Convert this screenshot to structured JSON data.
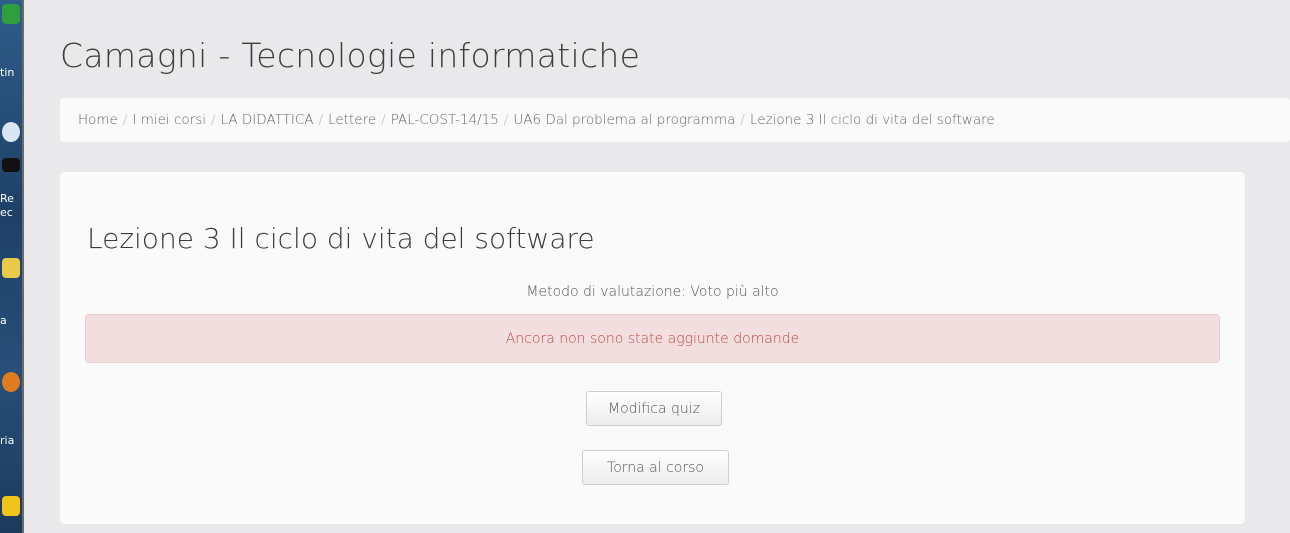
{
  "desktop": {
    "labels": [
      "tin",
      "Re",
      "ec",
      "a",
      "ria"
    ]
  },
  "site": {
    "title": "Camagni - Tecnologie informatiche"
  },
  "breadcrumb": {
    "items": [
      "Home",
      "I miei corsi",
      "LA DIDATTICA",
      "Lettere",
      "PAL-COST-14/15",
      "UA6 Dal problema al programma",
      "Lezione 3 Il ciclo di vita del software"
    ],
    "separator": "/"
  },
  "quiz": {
    "title": "Lezione 3 Il ciclo di vita del software",
    "grading_method": "Metodo di valutazione: Voto più alto",
    "alert": "Ancora non sono state aggiunte domande",
    "edit_button": "Modifica quiz",
    "back_button": "Torna al corso"
  }
}
